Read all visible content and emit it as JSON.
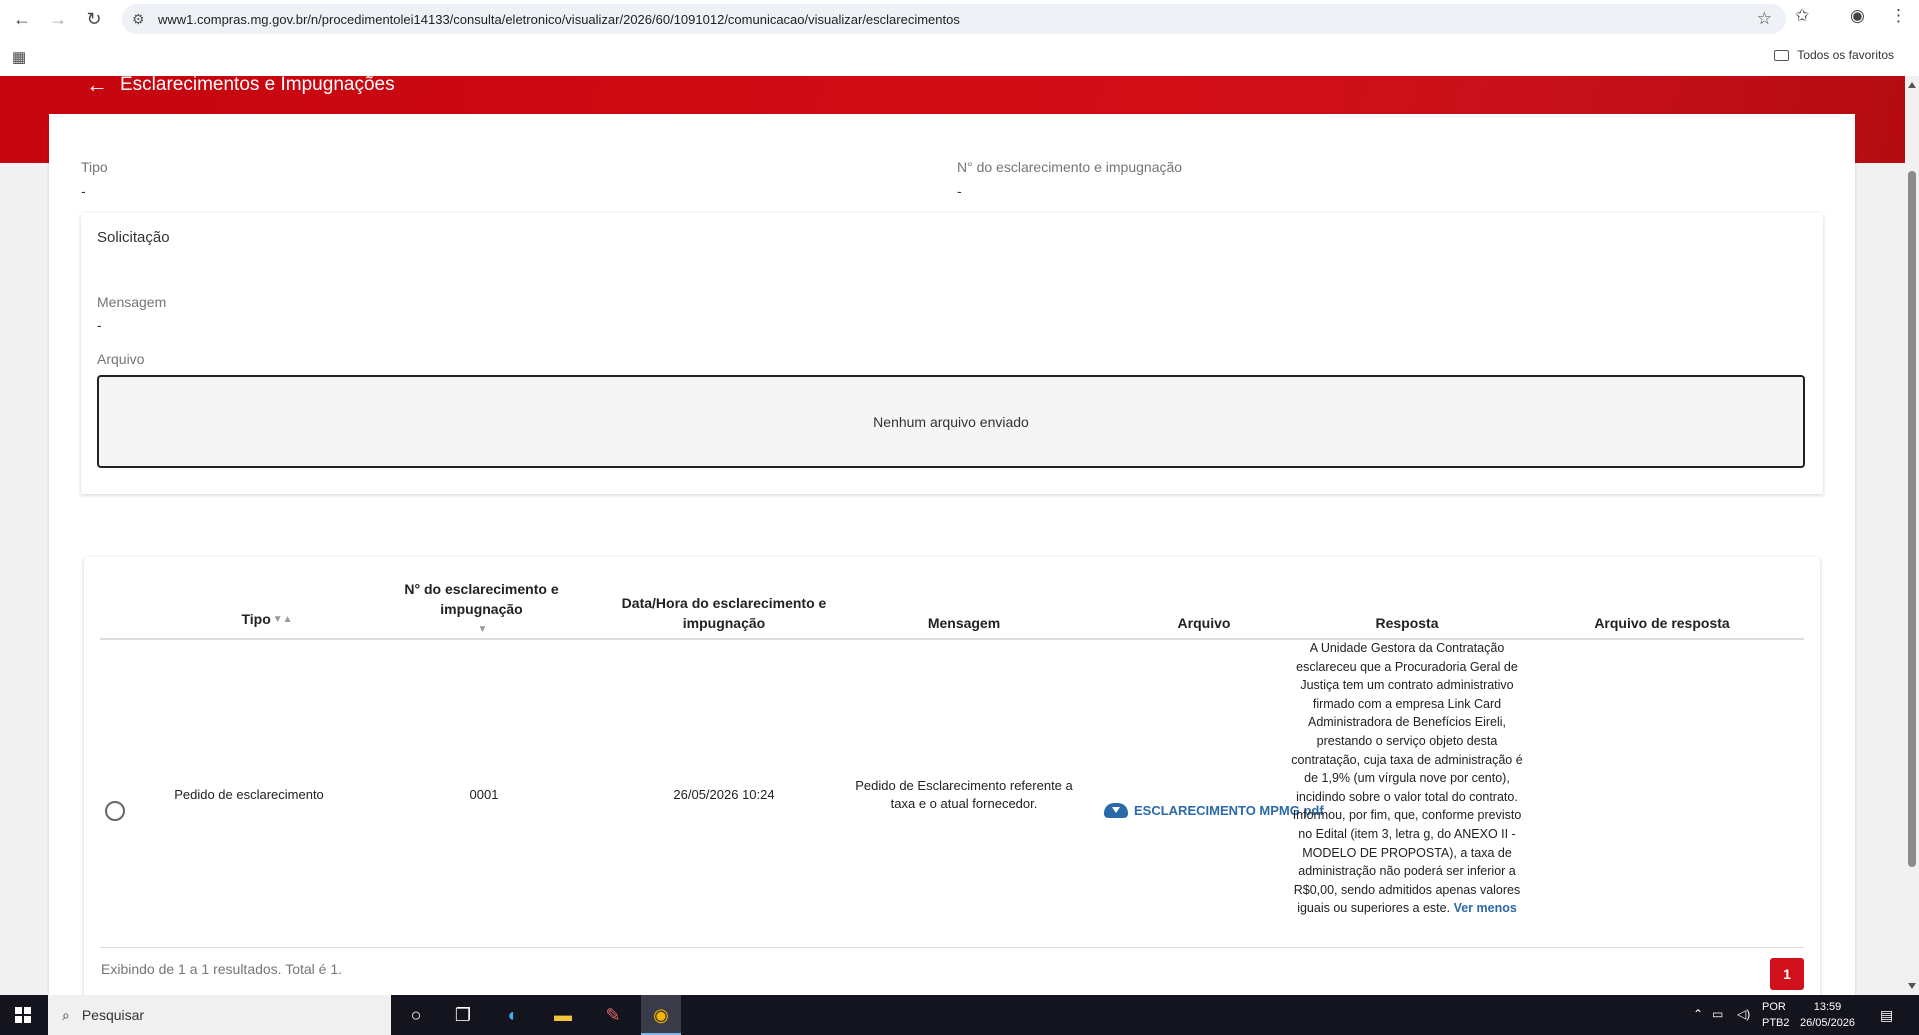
{
  "browser": {
    "url": "www1.compras.mg.gov.br/n/procedimentolei14133/consulta/eletronico/visualizar/2026/60/1091012/comunicacao/visualizar/esclarecimentos",
    "bookmarks_label": "Todos os favoritos"
  },
  "banner": {
    "title": "Esclarecimentos e Impugnações"
  },
  "details": {
    "tipo_label": "Tipo",
    "tipo_value": "-",
    "numero_label": "N° do esclarecimento e impugnação",
    "numero_value": "-"
  },
  "solicitacao": {
    "title": "Solicitação",
    "mensagem_label": "Mensagem",
    "mensagem_value": "-",
    "arquivo_label": "Arquivo",
    "arquivo_empty": "Nenhum arquivo enviado"
  },
  "table": {
    "headers": {
      "tipo": "Tipo",
      "numero": "N° do esclarecimento e impugnação",
      "data_1": "Data/Hora do esclarecimento e",
      "data_2": "impugnação",
      "mensagem": "Mensagem",
      "arquivo": "Arquivo",
      "resposta": "Resposta",
      "arquivo_resposta": "Arquivo de resposta"
    },
    "row": {
      "tipo": "Pedido de esclarecimento",
      "numero": "0001",
      "data": "26/05/2026 10:24",
      "mensagem_1": "Pedido de Esclarecimento referente a",
      "mensagem_2": "taxa e o atual fornecedor.",
      "arquivo": "ESCLARECIMENTO MPMG.pdf",
      "resposta": "A Unidade Gestora da Contratação esclareceu que a Procuradoria Geral de Justiça tem um contrato administrativo firmado com a empresa Link Card Administradora de Benefícios Eireli, prestando o serviço objeto desta contratação, cuja taxa de administração é de 1,9% (um vírgula nove por cento), incidindo sobre o valor total do contrato. Informou, por fim, que, conforme previsto no Edital (item 3, letra g, do ANEXO II - MODELO DE PROPOSTA), a taxa de administração não poderá ser inferior a R$0,00, sendo admitidos apenas valores iguais ou superiores a este.",
      "ver_menos": "Ver menos"
    },
    "footer": "Exibindo de 1 a 1 resultados. Total é 1.",
    "page": "1",
    "page_size": "10"
  },
  "taskbar": {
    "search_placeholder": "Pesquisar",
    "lang_1": "POR",
    "lang_2": "PTB2",
    "time": "13:59",
    "date": "26/05/2026"
  },
  "colors": {
    "brand_red": "#d0111b",
    "link_blue": "#2b6aa8"
  }
}
